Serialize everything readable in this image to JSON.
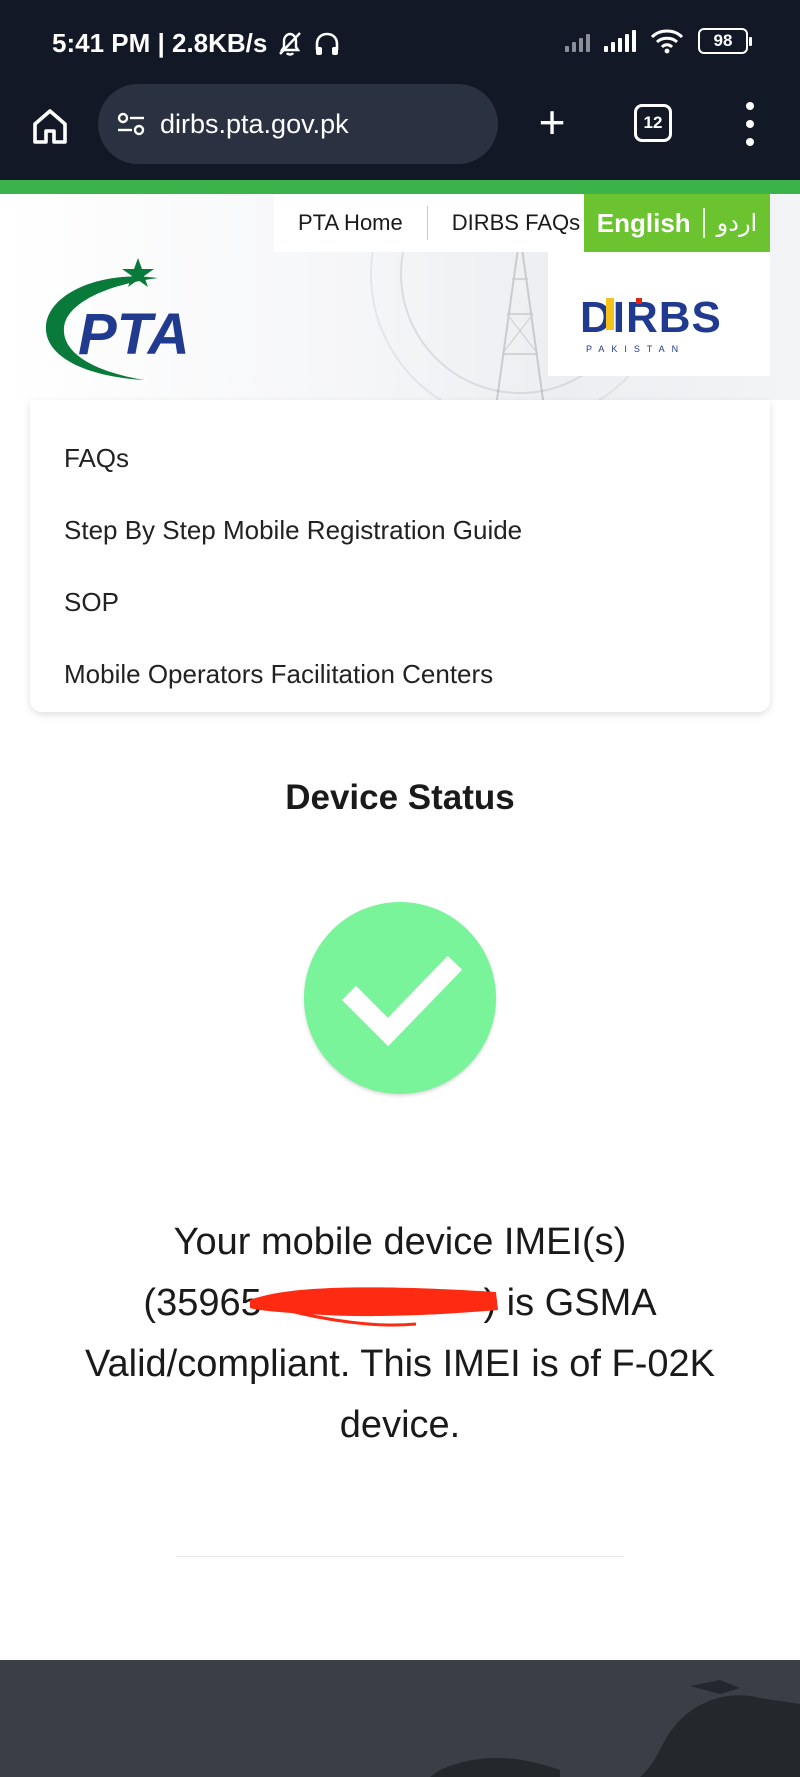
{
  "status_bar": {
    "time_speed": "5:41 PM | 2.8KB/s",
    "battery": "98"
  },
  "browser": {
    "url": "dirbs.pta.gov.pk",
    "tab_count": "12"
  },
  "header": {
    "top_links": [
      "PTA Home",
      "DIRBS FAQs"
    ],
    "language_active": "English",
    "language_alt": "اردو",
    "pta_logo_text": "PTA",
    "dirbs_logo_text": "DIRBS",
    "dirbs_sub": "PAKISTAN"
  },
  "menu": {
    "items": [
      "FAQs",
      "Step By Step Mobile Registration Guide",
      "SOP",
      "Mobile Operators Facilitation Centers"
    ]
  },
  "device_status": {
    "title": "Device Status",
    "line1": "Your mobile device IMEI(s)",
    "line2": "(35965                     ) is GSMA",
    "line3": "Valid/compliant. This IMEI is of F-02K",
    "line4": "device."
  },
  "colors": {
    "browser_bg": "#121826",
    "accent_green": "#3cb34a",
    "lang_green": "#6bc42f",
    "check_green": "#79f49a",
    "pta_green": "#0a7a3a",
    "pta_blue": "#1f3a8f"
  }
}
